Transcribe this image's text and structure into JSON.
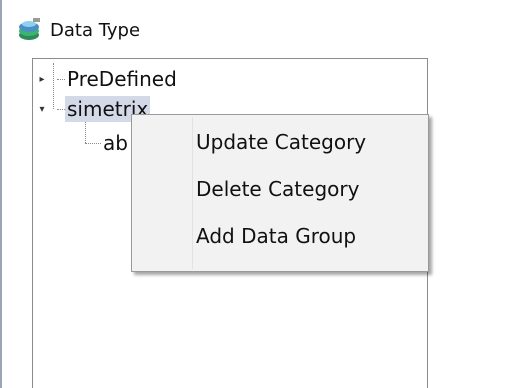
{
  "window": {
    "title": "Data Type",
    "icon": "data-type-app-icon"
  },
  "tree": {
    "nodes": [
      {
        "label": "PreDefined",
        "expanded": false,
        "selected": false
      },
      {
        "label": "simetrix",
        "expanded": true,
        "selected": true
      },
      {
        "label": "ab",
        "expanded": false,
        "selected": false
      }
    ]
  },
  "context_menu": {
    "items": [
      {
        "label": "Update Category"
      },
      {
        "label": "Delete Category"
      },
      {
        "label": "Add Data Group"
      }
    ]
  },
  "colors": {
    "selection": "#d3d9e6",
    "menu_background": "#f2f2f2",
    "border": "#8c8c8c"
  }
}
